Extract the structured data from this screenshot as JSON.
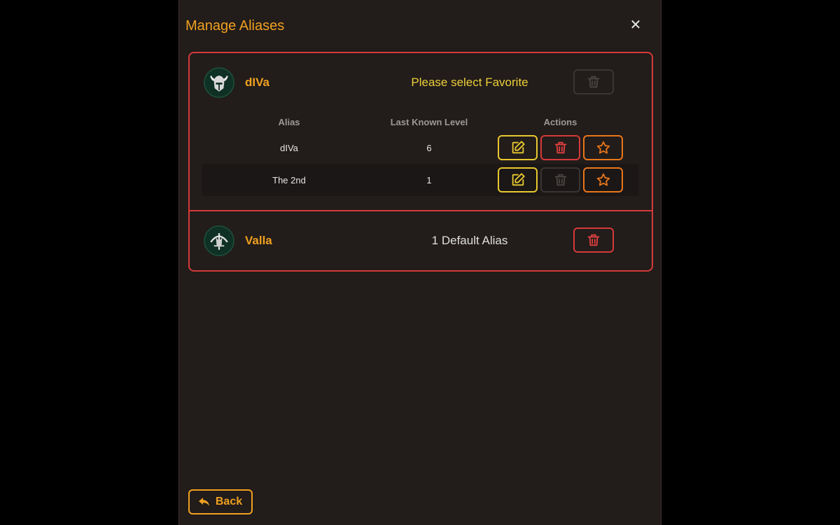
{
  "dialog": {
    "title": "Manage Aliases",
    "close_label": "✕"
  },
  "table_headers": {
    "alias": "Alias",
    "level": "Last Known Level",
    "actions": "Actions"
  },
  "heroes": [
    {
      "name": "dIVa",
      "avatar_icon": "viking-helmet-icon",
      "status": "Please select Favorite",
      "delete_enabled": false,
      "aliases": [
        {
          "alias": "dIVa",
          "level": "6",
          "delete_enabled": true
        },
        {
          "alias": "The 2nd",
          "level": "1",
          "delete_enabled": false
        }
      ]
    },
    {
      "name": "Valla",
      "avatar_icon": "crossbow-hunter-icon",
      "status": "1 Default Alias",
      "delete_enabled": true
    }
  ],
  "back_button": {
    "label": "Back",
    "icon": "reply-arrow-icon"
  },
  "colors": {
    "accent": "#f0a020",
    "danger": "#d43a3a",
    "edit": "#e8c830",
    "favorite": "#e8761a",
    "background": "#221c1a"
  }
}
